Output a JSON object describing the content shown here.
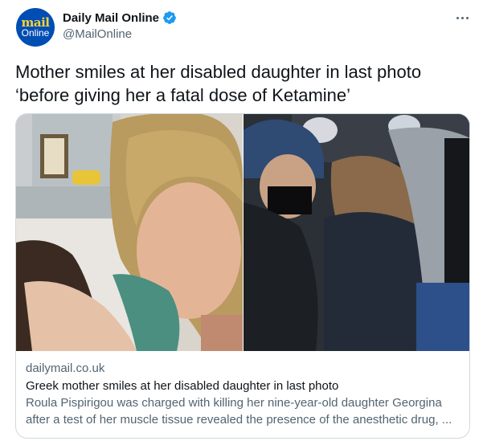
{
  "author": {
    "display_name": "Daily Mail Online",
    "handle": "@MailOnline",
    "verified": true,
    "avatar_logo_top": "mail",
    "avatar_logo_bottom": "Online"
  },
  "tweet": {
    "text": "Mother smiles at her disabled daughter in last photo ‘before giving her a fatal dose of Ketamine’"
  },
  "card": {
    "domain": "dailymail.co.uk",
    "title": "Greek mother smiles at her disabled daughter in last photo",
    "description_line1": "Roula Pispirigou was charged with killing her nine-year-old daughter Georgina",
    "description_line2": "after a test of her muscle tissue revealed the presence of the anesthetic drug, ..."
  },
  "icons": {
    "verified": "verified-badge-icon",
    "more": "more-options-icon"
  },
  "colors": {
    "accent": "#1d9bf0",
    "secondary_text": "#536471",
    "border": "#cfd9de",
    "avatar_bg": "#004db3"
  }
}
